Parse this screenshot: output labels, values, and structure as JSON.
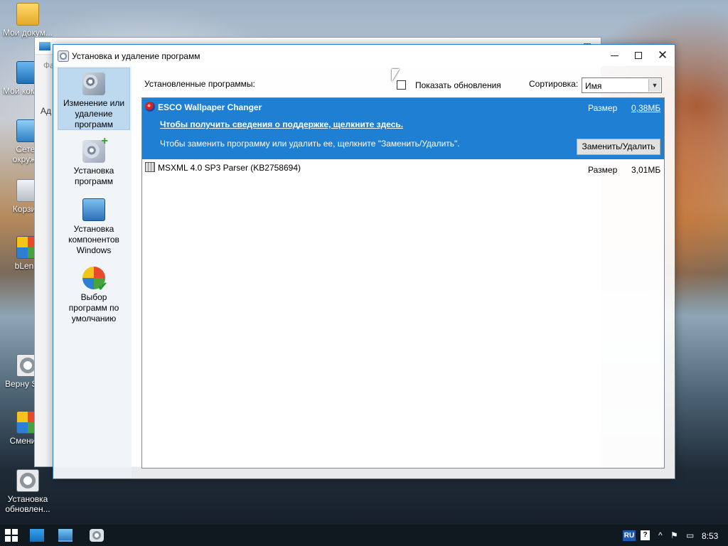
{
  "desktop": {
    "icons": [
      {
        "label": "Мои докум...",
        "icon": "folder-icon"
      },
      {
        "label": "Мой компь...",
        "icon": "computer-icon"
      },
      {
        "label": "Сетев окруж...",
        "icon": "network-icon"
      },
      {
        "label": "Корзи...",
        "icon": "recycle-bin-icon"
      },
      {
        "label": "bLen...",
        "icon": "app-icon"
      },
      {
        "label": "Верну Shell",
        "icon": "gear-icon"
      },
      {
        "label": "Сменит...",
        "icon": "app-icon"
      },
      {
        "label": "Установка обновлен...",
        "icon": "gear-icon"
      }
    ]
  },
  "background_window": {
    "fragments": [
      "Фа",
      "Ад"
    ]
  },
  "window": {
    "title": "Установка и удаление программ",
    "controls": {
      "minimize": "minimize",
      "maximize": "maximize",
      "close": "✕"
    }
  },
  "sidebar": {
    "items": [
      {
        "label": "Изменение или удаление программ",
        "icon": "change-remove-programs-icon",
        "selected": true
      },
      {
        "label": "Установка программ",
        "icon": "add-programs-icon",
        "selected": false
      },
      {
        "label": "Установка компонентов Windows",
        "icon": "windows-components-icon",
        "selected": false
      },
      {
        "label": "Выбор программ по умолчанию",
        "icon": "default-programs-icon",
        "selected": false
      }
    ]
  },
  "toolbar": {
    "installed_label": "Установленные программы:",
    "show_updates_label": "Показать обновления",
    "show_updates_checked": false,
    "sort_label": "Сортировка:",
    "sort_value": "Имя"
  },
  "programs": [
    {
      "name": "ESCO Wallpaper Changer",
      "size_label": "Размер",
      "size_value": "0,38МБ",
      "support_link": "Чтобы получить сведения о поддержке, щелкните здесь.",
      "change_text": "Чтобы заменить программу или удалить  ее, щелкните \"Заменить/Удалить\".",
      "button_label": "Заменить/Удалить",
      "selected": true
    },
    {
      "name": "MSXML 4.0 SP3 Parser (KB2758694)",
      "size_label": "Размер",
      "size_value": "3,01МБ",
      "selected": false
    }
  ],
  "taskbar": {
    "language": "RU",
    "help": "?",
    "time": "8:53"
  }
}
